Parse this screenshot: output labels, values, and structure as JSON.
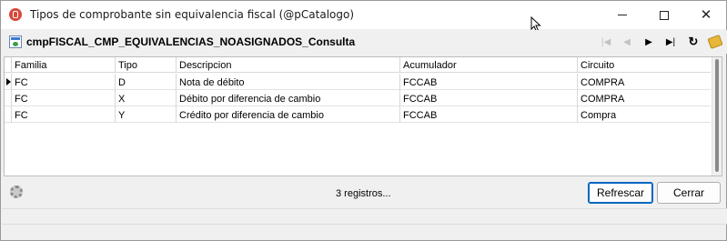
{
  "window": {
    "title": "Tipos de comprobante sin equivalencia fiscal (@pCatalogo)",
    "controls": {
      "minimize": "—",
      "maximize": "☐",
      "close": "✕"
    }
  },
  "subheader": {
    "title": "cmpFISCAL_CMP_EQUIVALENCIAS_NOASIGNADOS_Consulta",
    "nav": {
      "first": "|◀",
      "prev": "◀",
      "next": "▶",
      "last": "▶|",
      "refresh": "↻"
    }
  },
  "grid": {
    "columns": [
      "Familia",
      "Tipo",
      "Descripcion",
      "Acumulador",
      "Circuito"
    ],
    "rows": [
      {
        "familia": "FC",
        "tipo": "D",
        "descripcion": "Nota de débito",
        "acumulador": "FCCAB",
        "circuito": "COMPRA"
      },
      {
        "familia": "FC",
        "tipo": "X",
        "descripcion": "Débito por diferencia de cambio",
        "acumulador": "FCCAB",
        "circuito": "COMPRA"
      },
      {
        "familia": "FC",
        "tipo": "Y",
        "descripcion": "Crédito por diferencia de cambio",
        "acumulador": "FCCAB",
        "circuito": "Compra"
      }
    ]
  },
  "footer": {
    "record_count": "3 registros...",
    "refresh_label": "Refrescar",
    "close_label": "Cerrar"
  },
  "colors": {
    "accent": "#0067c0",
    "app_icon": "#d9483b"
  }
}
